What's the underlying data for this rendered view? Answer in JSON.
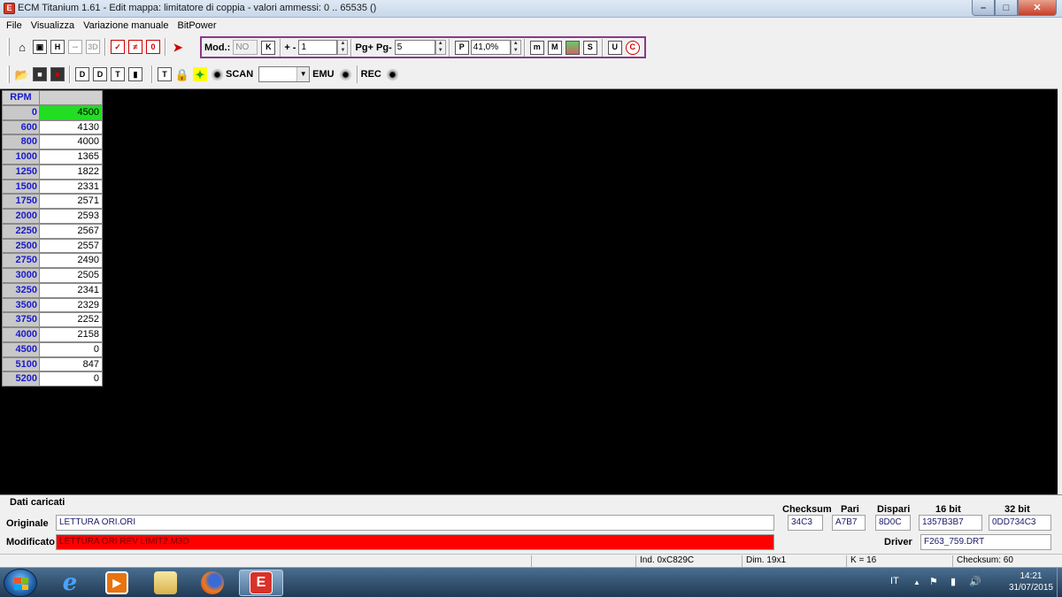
{
  "window": {
    "title": "ECM Titanium 1.61 - Edit mappa: limitatore di coppia - valori ammessi: 0 .. 65535 ()",
    "minimize": "–",
    "maximize": "□",
    "close": "✕"
  },
  "menu": [
    "File",
    "Visualizza",
    "Variazione manuale",
    "BitPower"
  ],
  "toolbar1": {
    "icons": [
      "home-icon",
      "windows-icon",
      "hex-view-icon",
      "chart-2d-icon",
      "chart-3d-icon",
      "check-icon",
      "compare-icon",
      "zero-icon",
      "arrow-icon"
    ],
    "mod_label": "Mod.:",
    "mod_value": "NO",
    "k_label": "K",
    "plusminus_label": "+ -",
    "step_value": "1",
    "pg_label": "Pg+ Pg-",
    "pg_value": "5",
    "p_label": "P",
    "percent_value": "41,0%",
    "right_icons": [
      "m",
      "M",
      "map",
      "S",
      "U",
      "C"
    ]
  },
  "toolbar2": {
    "scan_label": "SCAN",
    "emu_label": "EMU",
    "rec_label": "REC",
    "scan_value": ""
  },
  "table": {
    "header": "RPM",
    "rows": [
      {
        "rpm": "0",
        "value": "4500"
      },
      {
        "rpm": "600",
        "value": "4130"
      },
      {
        "rpm": "800",
        "value": "4000"
      },
      {
        "rpm": "1000",
        "value": "1365"
      },
      {
        "rpm": "1250",
        "value": "1822"
      },
      {
        "rpm": "1500",
        "value": "2331"
      },
      {
        "rpm": "1750",
        "value": "2571"
      },
      {
        "rpm": "2000",
        "value": "2593"
      },
      {
        "rpm": "2250",
        "value": "2567"
      },
      {
        "rpm": "2500",
        "value": "2557"
      },
      {
        "rpm": "2750",
        "value": "2490"
      },
      {
        "rpm": "3000",
        "value": "2505"
      },
      {
        "rpm": "3250",
        "value": "2341"
      },
      {
        "rpm": "3500",
        "value": "2329"
      },
      {
        "rpm": "3750",
        "value": "2252"
      },
      {
        "rpm": "4000",
        "value": "2158"
      },
      {
        "rpm": "4500",
        "value": "0"
      },
      {
        "rpm": "5100",
        "value": "847"
      },
      {
        "rpm": "5200",
        "value": "0"
      }
    ]
  },
  "bottom": {
    "section_title": "Dati caricati",
    "originale_label": "Originale",
    "originale_value": "LETTURA ORI.ORI",
    "modificato_label": "Modificato",
    "modificato_value": "LETTURA ORI REV LIMIT2.M3D",
    "checksum_label": "Checksum",
    "checksum_value": "34C3",
    "pari_label": "Pari",
    "pari_value": "A7B7",
    "dispari_label": "Dispari",
    "dispari_value": "8D0C",
    "bit16_label": "16 bit",
    "bit16_value": "1357B3B7",
    "bit32_label": "32 bit",
    "bit32_value": "0DD734C3",
    "driver_label": "Driver",
    "driver_value": "F263_759.DRT"
  },
  "status": {
    "ind": "Ind. 0xC829C",
    "dim": "Dim. 19x1",
    "k": "K = 16",
    "checksum": "Checksum: 60"
  },
  "taskbar": {
    "lang": "IT",
    "time": "14:21",
    "date": "31/07/2015"
  },
  "colors": {
    "selected_cell": "#22dd22",
    "modified_field": "#ff0000",
    "rpm_text": "#1a1acc",
    "mod_group_border": "#8a3a8a"
  }
}
